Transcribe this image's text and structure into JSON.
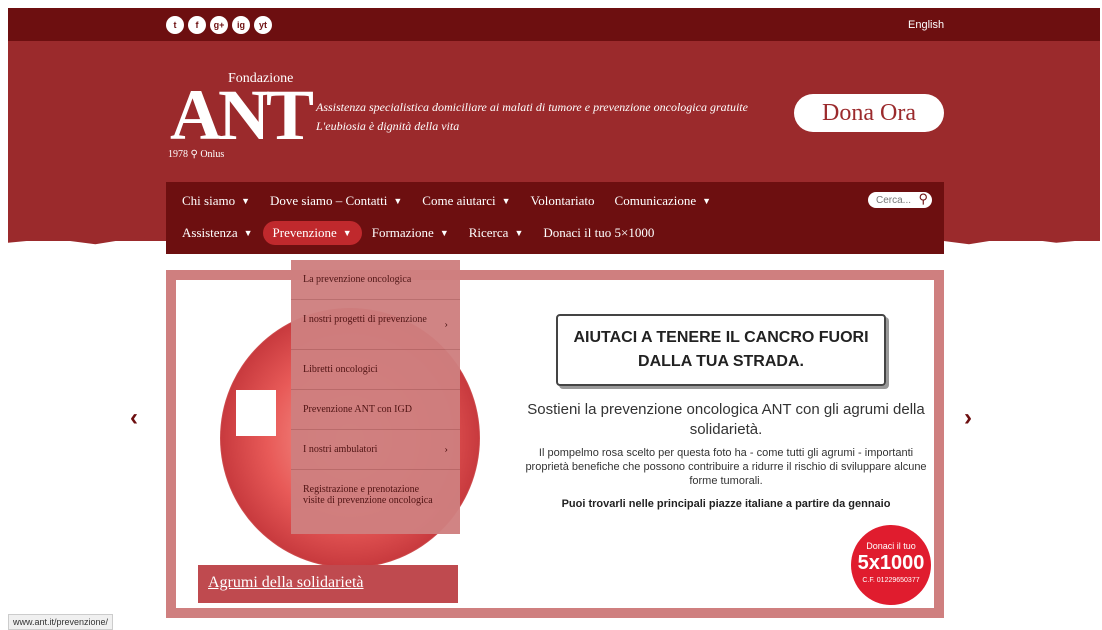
{
  "social": [
    "t",
    "f",
    "g+",
    "ig",
    "yt"
  ],
  "language": "English",
  "logo": {
    "fondazione": "Fondazione",
    "ant": "ANT",
    "year": "1978",
    "onlus": "Onlus"
  },
  "tagline": [
    "Assistenza specialistica domiciliare ai malati di tumore e prevenzione oncologica gratuite",
    "L'eubiosia è dignità della vita"
  ],
  "donate_label": "Dona Ora",
  "nav": {
    "row1": [
      "Chi siamo",
      "Dove siamo – Contatti",
      "Come aiutarci",
      "Volontariato",
      "Comunicazione"
    ],
    "row2": [
      "Assistenza",
      "Prevenzione",
      "Formazione",
      "Ricerca",
      "Donaci il tuo 5×1000"
    ],
    "search_placeholder": "Cerca..."
  },
  "dropdown": [
    "La prevenzione oncologica",
    "I nostri progetti di prevenzione",
    "Libretti oncologici",
    "Prevenzione ANT con IGD",
    "I nostri ambulatori",
    "Registrazione e prenotazione visite di prevenzione oncologica"
  ],
  "slide": {
    "headline": "AIUTACI A TENERE IL CANCRO FUORI DALLA TUA STRADA.",
    "sub": "Sostieni la prevenzione oncologica ANT con gli agrumi della solidarietà.",
    "text": "Il pompelmo rosa scelto per questa foto ha - come tutti gli agrumi - importanti proprietà benefiche che possono contribuire a ridurre il rischio di sviluppare alcune forme tumorali.",
    "bold": "Puoi trovarli nelle principali piazze italiane a partire da gennaio",
    "badge": {
      "top": "Donaci il tuo",
      "big": "5x1000",
      "cf": "C.F. 01229650377"
    },
    "caption": "Agrumi della solidarietà"
  },
  "status_url": "www.ant.it/prevenzione/"
}
